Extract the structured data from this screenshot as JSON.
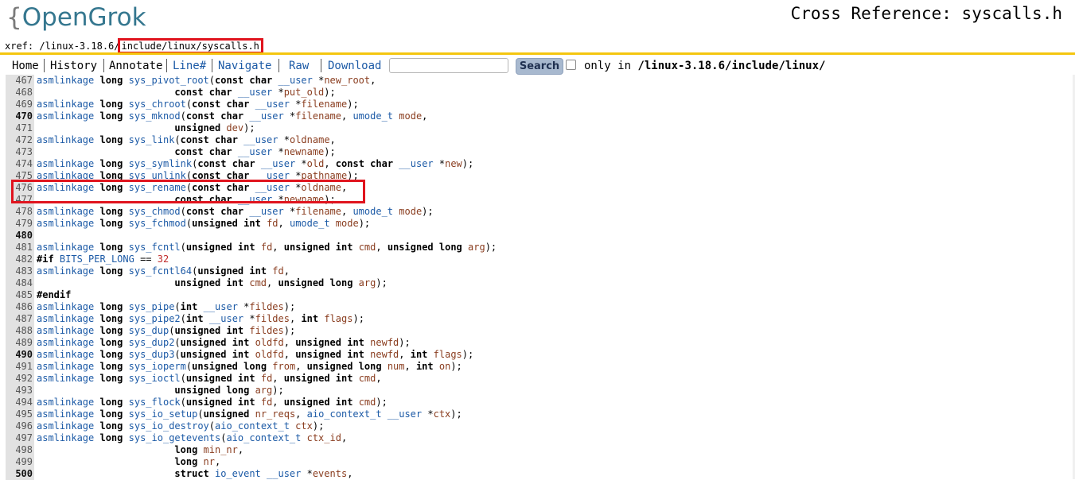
{
  "header": {
    "logo_brace": "{",
    "logo_text": "OpenGrok",
    "title": "Cross Reference: syscalls.h"
  },
  "breadcrumb": {
    "prefix": "xref: /linux-3.18.6/",
    "highlighted": "include/linux/syscalls.h"
  },
  "nav": {
    "home": "Home",
    "history": "History",
    "annotate": "Annotate",
    "line": "Line#",
    "navigate": "Navigate",
    "raw": "Raw",
    "download": "Download",
    "search_value": "",
    "search_button": "Search",
    "only_in_label": "only in",
    "only_in_path": "/linux-3.18.6/include/linux/"
  },
  "accent_colors": {
    "highlight_box": "#e0141e",
    "rule": "#f4c60f",
    "link": "#1c5aa6"
  },
  "code_lines": [
    {
      "n": "467",
      "src": "asmlinkage long sys_pivot_root(const char __user *new_root,"
    },
    {
      "n": "468",
      "src": "                        const char __user *put_old);"
    },
    {
      "n": "469",
      "src": "asmlinkage long sys_chroot(const char __user *filename);"
    },
    {
      "n": "470",
      "src": "asmlinkage long sys_mknod(const char __user *filename, umode_t mode,",
      "bold": true
    },
    {
      "n": "471",
      "src": "                        unsigned dev);"
    },
    {
      "n": "472",
      "src": "asmlinkage long sys_link(const char __user *oldname,"
    },
    {
      "n": "473",
      "src": "                        const char __user *newname);"
    },
    {
      "n": "474",
      "src": "asmlinkage long sys_symlink(const char __user *old, const char __user *new);"
    },
    {
      "n": "475",
      "src": "asmlinkage long sys_unlink(const char __user *pathname);"
    },
    {
      "n": "476",
      "src": "asmlinkage long sys_rename(const char __user *oldname,"
    },
    {
      "n": "477",
      "src": "                        const char __user *newname);"
    },
    {
      "n": "478",
      "src": "asmlinkage long sys_chmod(const char __user *filename, umode_t mode);"
    },
    {
      "n": "479",
      "src": "asmlinkage long sys_fchmod(unsigned int fd, umode_t mode);"
    },
    {
      "n": "480",
      "src": "",
      "bold": true
    },
    {
      "n": "481",
      "src": "asmlinkage long sys_fcntl(unsigned int fd, unsigned int cmd, unsigned long arg);"
    },
    {
      "n": "482",
      "src": "#if BITS_PER_LONG == 32"
    },
    {
      "n": "483",
      "src": "asmlinkage long sys_fcntl64(unsigned int fd,"
    },
    {
      "n": "484",
      "src": "                        unsigned int cmd, unsigned long arg);"
    },
    {
      "n": "485",
      "src": "#endif"
    },
    {
      "n": "486",
      "src": "asmlinkage long sys_pipe(int __user *fildes);"
    },
    {
      "n": "487",
      "src": "asmlinkage long sys_pipe2(int __user *fildes, int flags);"
    },
    {
      "n": "488",
      "src": "asmlinkage long sys_dup(unsigned int fildes);"
    },
    {
      "n": "489",
      "src": "asmlinkage long sys_dup2(unsigned int oldfd, unsigned int newfd);"
    },
    {
      "n": "490",
      "src": "asmlinkage long sys_dup3(unsigned int oldfd, unsigned int newfd, int flags);",
      "bold": true
    },
    {
      "n": "491",
      "src": "asmlinkage long sys_ioperm(unsigned long from, unsigned long num, int on);"
    },
    {
      "n": "492",
      "src": "asmlinkage long sys_ioctl(unsigned int fd, unsigned int cmd,"
    },
    {
      "n": "493",
      "src": "                        unsigned long arg);"
    },
    {
      "n": "494",
      "src": "asmlinkage long sys_flock(unsigned int fd, unsigned int cmd);"
    },
    {
      "n": "495",
      "src": "asmlinkage long sys_io_setup(unsigned nr_reqs, aio_context_t __user *ctx);"
    },
    {
      "n": "496",
      "src": "asmlinkage long sys_io_destroy(aio_context_t ctx);"
    },
    {
      "n": "497",
      "src": "asmlinkage long sys_io_getevents(aio_context_t ctx_id,"
    },
    {
      "n": "498",
      "src": "                        long min_nr,"
    },
    {
      "n": "499",
      "src": "                        long nr,"
    },
    {
      "n": "500",
      "src": "                        struct io_event __user *events,",
      "bold": true
    }
  ]
}
